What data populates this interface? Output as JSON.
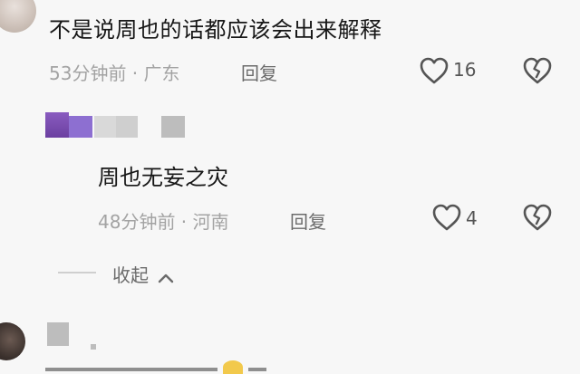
{
  "comment1": {
    "text": "不是说周也的话都应该会出来解释",
    "time_location": "53分钟前 · 广东",
    "reply_label": "回复",
    "like_count": "16"
  },
  "comment2": {
    "text": "周也无妄之灾",
    "time_location": "48分钟前 · 河南",
    "reply_label": "回复",
    "like_count": "4"
  },
  "collapse": {
    "label": "收起",
    "chevron": "^"
  },
  "icons": {
    "like": "heart-outline-icon",
    "dislike": "broken-heart-icon"
  },
  "colors": {
    "background": "#f7f7f7",
    "text": "#161616",
    "meta": "#a3a3a3"
  }
}
